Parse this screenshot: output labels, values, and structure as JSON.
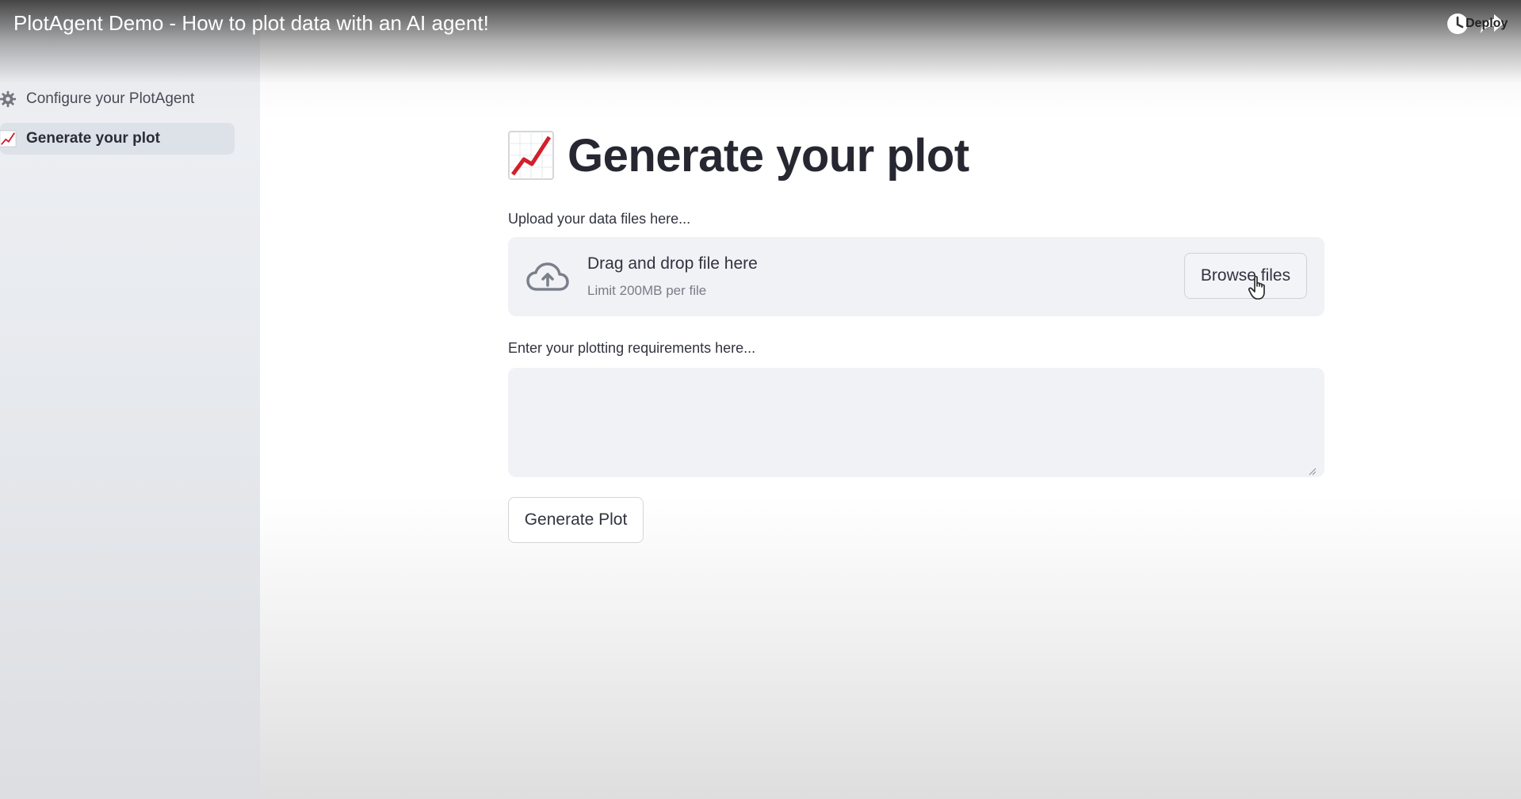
{
  "video": {
    "title": "PlotAgent Demo - How to plot data with an AI agent!",
    "behind_label": "Deploy",
    "icons": [
      "clock-icon",
      "share-icon"
    ]
  },
  "sidebar": {
    "items": [
      {
        "label": "Configure your PlotAgent",
        "icon": "gear-icon",
        "active": false
      },
      {
        "label": "Generate your plot",
        "icon": "chart-increasing-icon",
        "active": true
      }
    ]
  },
  "main": {
    "title": "Generate your plot",
    "title_icon": "chart-increasing-icon",
    "upload": {
      "label": "Upload your data files here...",
      "drag_text": "Drag and drop file here",
      "limit_text": "Limit 200MB per file",
      "browse_label": "Browse files"
    },
    "requirements": {
      "label": "Enter your plotting requirements here...",
      "value": ""
    },
    "generate_label": "Generate Plot"
  },
  "colors": {
    "sidebar_bg": "#eef0f4",
    "active_item_bg": "#dde1e8",
    "input_bg": "#f0f2f6",
    "text": "#31333f",
    "chart_red": "#d1202c"
  }
}
